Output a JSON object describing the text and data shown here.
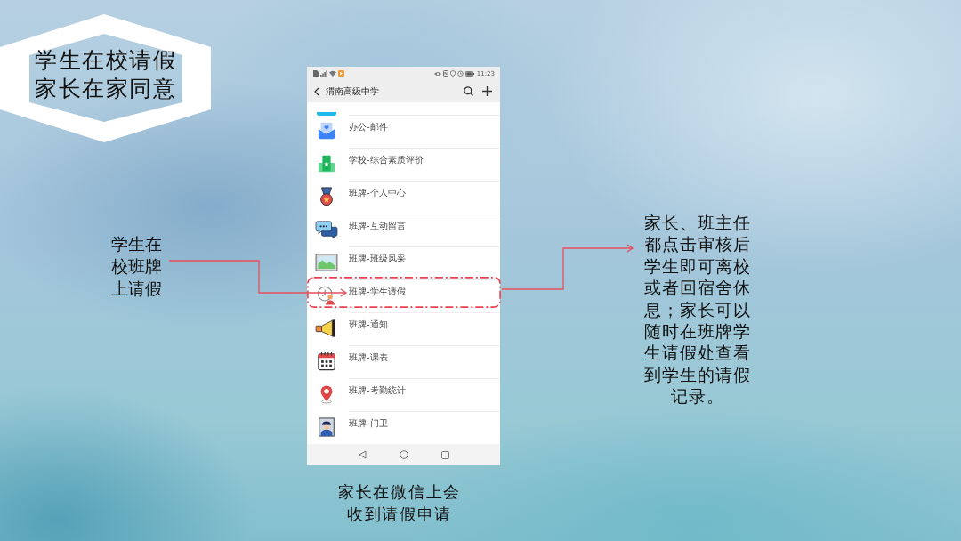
{
  "title_badge": {
    "lines": [
      "学生在校请假",
      "家长在家同意"
    ]
  },
  "left_caption": {
    "text": "学生在校班牌上请假"
  },
  "phone": {
    "status_bar": {
      "time": "11:23"
    },
    "header": {
      "title": "渭南高级中学"
    },
    "menu_items": [
      {
        "label": "办公-邮件",
        "highlighted": false
      },
      {
        "label": "学校-综合素质评价",
        "highlighted": false
      },
      {
        "label": "班牌-个人中心",
        "highlighted": false
      },
      {
        "label": "班牌-互动留言",
        "highlighted": false
      },
      {
        "label": "班牌-班级风采",
        "highlighted": false
      },
      {
        "label": "班牌-学生请假",
        "highlighted": true
      },
      {
        "label": "班牌-通知",
        "highlighted": false
      },
      {
        "label": "班牌-课表",
        "highlighted": false
      },
      {
        "label": "班牌-考勤统计",
        "highlighted": false
      },
      {
        "label": "班牌-门卫",
        "highlighted": false
      }
    ]
  },
  "right_caption": {
    "text": "家长、班主任都点击审核后学生即可离校或者回宿舍休息；家长可以随时在班牌学生请假处查看到学生的请假记录。"
  },
  "bottom_caption": {
    "text": "家长在微信上会收到请假申请"
  }
}
